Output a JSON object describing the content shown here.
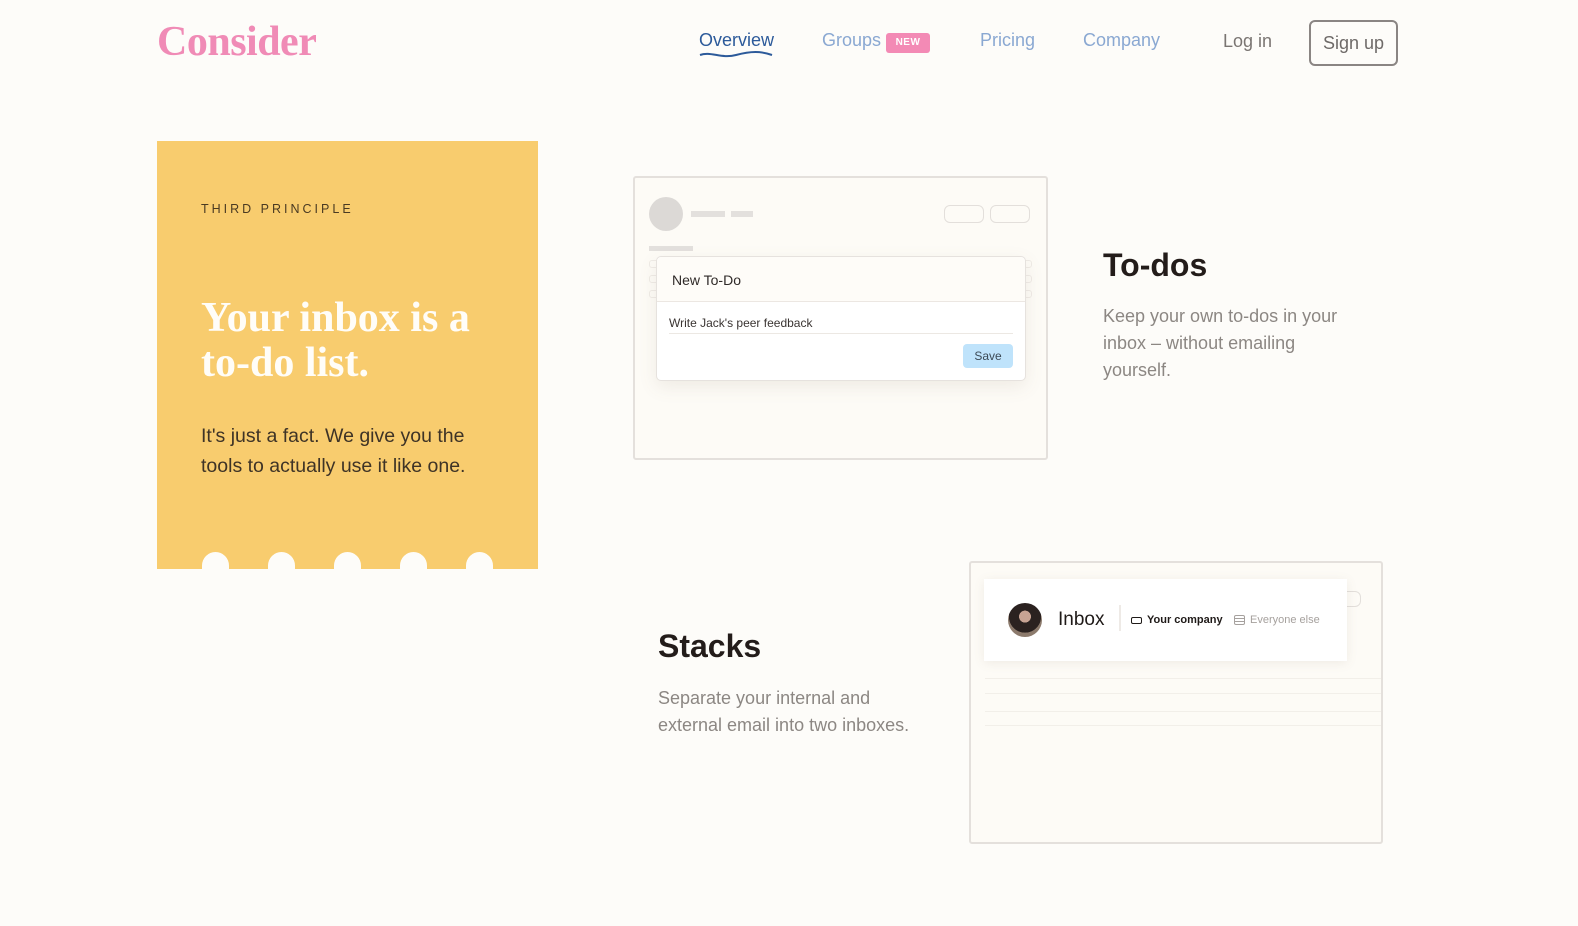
{
  "header": {
    "logo": "Consider",
    "nav": [
      {
        "label": "Overview",
        "active": true
      },
      {
        "label": "Groups",
        "badge": "NEW"
      },
      {
        "label": "Pricing"
      },
      {
        "label": "Company"
      }
    ],
    "login_label": "Log in",
    "signup_label": "Sign up"
  },
  "principle": {
    "eyebrow": "THIRD PRINCIPLE",
    "title": "Your inbox is a to-do list.",
    "body": "It's just a fact. We give you the tools to actually use it like one.",
    "color": "#f8cc6e"
  },
  "todos": {
    "modal_title": "New To-Do",
    "input_value": "Write Jack's peer feedback",
    "save_label": "Save",
    "title": "To-dos",
    "description": "Keep your own to-dos in your inbox – without emailing yourself."
  },
  "stacks": {
    "inbox_label": "Inbox",
    "tabs": [
      {
        "label": "Your company",
        "icon": "tray-icon",
        "active": true
      },
      {
        "label": "Everyone else",
        "icon": "list-icon",
        "active": false
      }
    ],
    "title": "Stacks",
    "description": "Separate your internal and external email into two inboxes."
  },
  "colors": {
    "brand_pink": "#f08bb6",
    "nav_active": "#2c5a9a",
    "nav_inactive": "#8aa8d2",
    "save_button": "#bfe3fb"
  }
}
